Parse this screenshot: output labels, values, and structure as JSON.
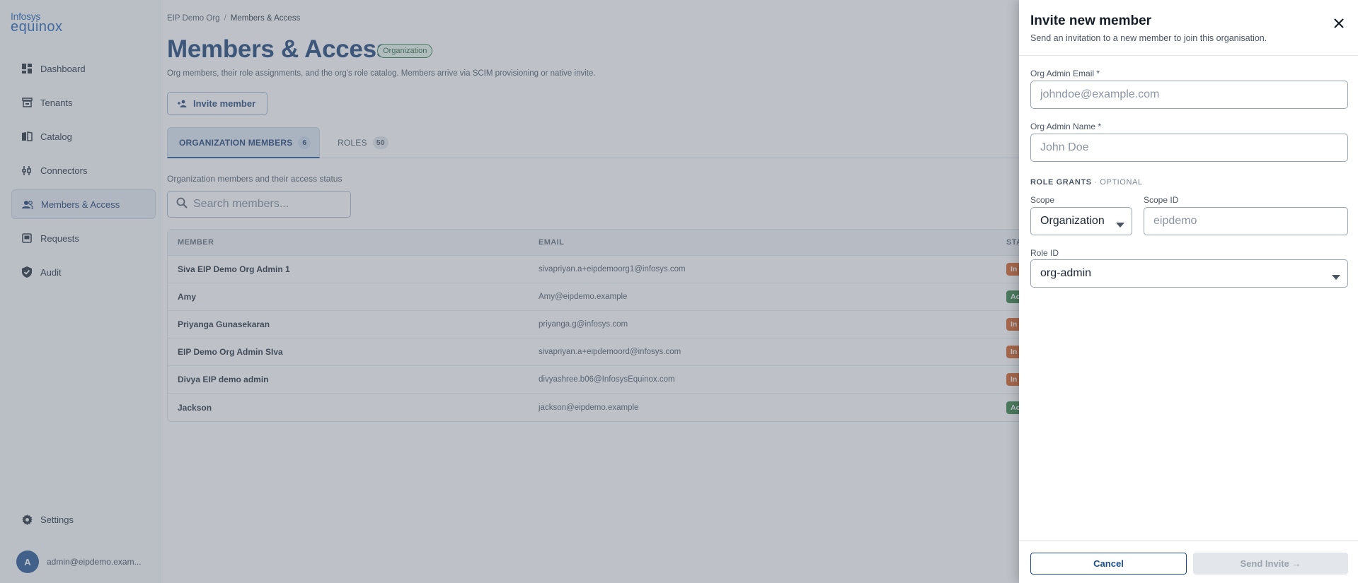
{
  "app": {
    "logo_top": "Infosys",
    "logo_bottom": "equinox"
  },
  "sidebar": {
    "items": [
      {
        "label": "Dashboard",
        "icon": "dashboard-icon"
      },
      {
        "label": "Tenants",
        "icon": "store-icon"
      },
      {
        "label": "Catalog",
        "icon": "book-icon"
      },
      {
        "label": "Connectors",
        "icon": "plug-icon"
      },
      {
        "label": "Members & Access",
        "icon": "people-icon",
        "active": true
      },
      {
        "label": "Requests",
        "icon": "inbox-icon"
      },
      {
        "label": "Audit",
        "icon": "shield-check-icon"
      }
    ],
    "settings_label": "Settings",
    "user_initial": "A",
    "user_email": "admin@eipdemo.exam..."
  },
  "header": {
    "breadcrumb_root": "EIP Demo Org",
    "breadcrumb_sep": "/",
    "breadcrumb_current": "Members & Access",
    "title": "Members & Access",
    "badge": "Organization",
    "subtitle": "Org members, their role assignments, and the org's role catalog. Members arrive via SCIM provisioning or native invite.",
    "invite_button": "Invite member"
  },
  "tabs": [
    {
      "label": "ORGANIZATION MEMBERS",
      "count": "6"
    },
    {
      "label": "ROLES",
      "count": "50"
    }
  ],
  "members": {
    "description": "Organization members and their access status",
    "search_placeholder": "Search members...",
    "columns": [
      "MEMBER",
      "EMAIL",
      "STA"
    ],
    "rows": [
      {
        "name": "Siva EIP Demo Org Admin 1",
        "email": "sivapriyan.a+eipdemoorg1@infosys.com",
        "status": "In",
        "status_color": "#d2591e"
      },
      {
        "name": "Amy",
        "email": "Amy@eipdemo.example",
        "status": "Ac",
        "status_color": "#2f7a3c"
      },
      {
        "name": "Priyanga Gunasekaran",
        "email": "priyanga.g@infosys.com",
        "status": "In",
        "status_color": "#d2591e"
      },
      {
        "name": "EIP Demo Org Admin SIva",
        "email": "sivapriyan.a+eipdemoord@infosys.com",
        "status": "In",
        "status_color": "#d2591e"
      },
      {
        "name": "Divya EIP demo admin",
        "email": "divyashree.b06@InfosysEquinox.com",
        "status": "In",
        "status_color": "#d2591e"
      },
      {
        "name": "Jackson",
        "email": "jackson@eipdemo.example",
        "status": "Ac",
        "status_color": "#2f7a3c"
      }
    ]
  },
  "drawer": {
    "title": "Invite new member",
    "subtitle": "Send an invitation to a new member to join this organisation.",
    "email_label": "Org Admin Email *",
    "email_placeholder": "johndoe@example.com",
    "name_label": "Org Admin Name *",
    "name_placeholder": "John Doe",
    "role_grants_title": "ROLE GRANTS",
    "role_grants_optional": " · OPTIONAL",
    "scope_label": "Scope",
    "scope_value": "Organization",
    "scope_id_label": "Scope ID",
    "scope_id_placeholder": "eipdemo",
    "role_id_label": "Role ID",
    "role_id_value": "org-admin",
    "cancel_label": "Cancel",
    "send_label": "Send Invite →"
  },
  "colors": {
    "brand": "#143c74",
    "accent": "#1c4d8f",
    "invited": "#d2591e",
    "active": "#2f7a3c"
  }
}
